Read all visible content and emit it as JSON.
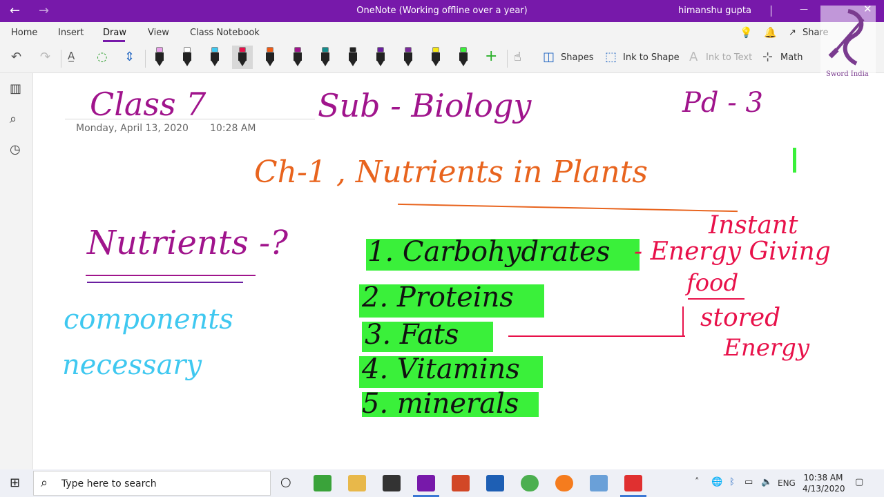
{
  "titlebar": {
    "title": "OneNote (Working offline over a year)",
    "user": "himanshu gupta",
    "back_glyph": "←",
    "forward_glyph": "→",
    "minimize_glyph": "—",
    "close_glyph": "✕",
    "color": "#7719aa"
  },
  "ribbon": {
    "tabs": [
      {
        "label": "Home"
      },
      {
        "label": "Insert"
      },
      {
        "label": "Draw",
        "active": true
      },
      {
        "label": "View"
      },
      {
        "label": "Class Notebook"
      }
    ],
    "share_label": "Share"
  },
  "toolbar": {
    "undo_icon": "undo-icon",
    "redo_icon": "redo-icon",
    "shapes_label": "Shapes",
    "ink_to_shape_label": "Ink to Shape",
    "ink_to_text_label": "Ink to Text",
    "math_label": "Math",
    "pens": [
      {
        "color": "#e8a0e8"
      },
      {
        "color": "#ffffff"
      },
      {
        "color": "#3fc8f0"
      },
      {
        "color": "#e8114a"
      },
      {
        "color": "#f05a14"
      },
      {
        "color": "#a0148c"
      },
      {
        "color": "#148c8c"
      },
      {
        "color": "#222222"
      },
      {
        "color": "#6a1ea0"
      },
      {
        "color": "#7a2a9a"
      },
      {
        "color": "#f5e614"
      },
      {
        "color": "#3af03a"
      }
    ]
  },
  "page": {
    "date": "Monday, April 13, 2020",
    "time": "10:28 AM"
  },
  "ink": {
    "class": "Class 7",
    "subject": "Sub - Biology",
    "period": "Pd - 3",
    "chapter": "Ch-1 , Nutrients in Plants",
    "nutrients_q": "Nutrients -?",
    "components": "components",
    "necessary": "necessary",
    "list": [
      "1. Carbohydrates",
      "2. Proteins",
      "3. Fats",
      "4. Vitamins",
      "5. minerals"
    ],
    "instant": "Instant",
    "energy_giving": "- Energy Giving",
    "food": "food",
    "stored": "stored",
    "energy": "Energy",
    "highlight_color": "#3af03a"
  },
  "watermark": {
    "text": "Sword India"
  },
  "taskbar": {
    "search_placeholder": "Type here to search",
    "lang": "ENG",
    "time": "10:38 AM",
    "date": "4/13/2020"
  }
}
